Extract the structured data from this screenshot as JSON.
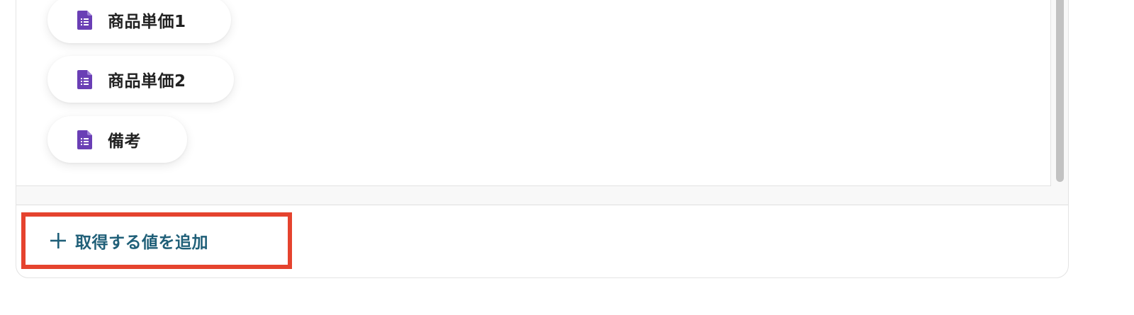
{
  "fields": {
    "items": [
      {
        "label": "商品単価1",
        "icon": "form-document-icon"
      },
      {
        "label": "商品単価2",
        "icon": "form-document-icon"
      },
      {
        "label": "備考",
        "icon": "form-document-icon"
      }
    ]
  },
  "actions": {
    "add_label": "取得する値を追加",
    "add_icon": "plus-icon"
  },
  "colors": {
    "doc_icon": "#6a3fb5",
    "add_text": "#1f5f78",
    "highlight_border": "#e5432e"
  }
}
